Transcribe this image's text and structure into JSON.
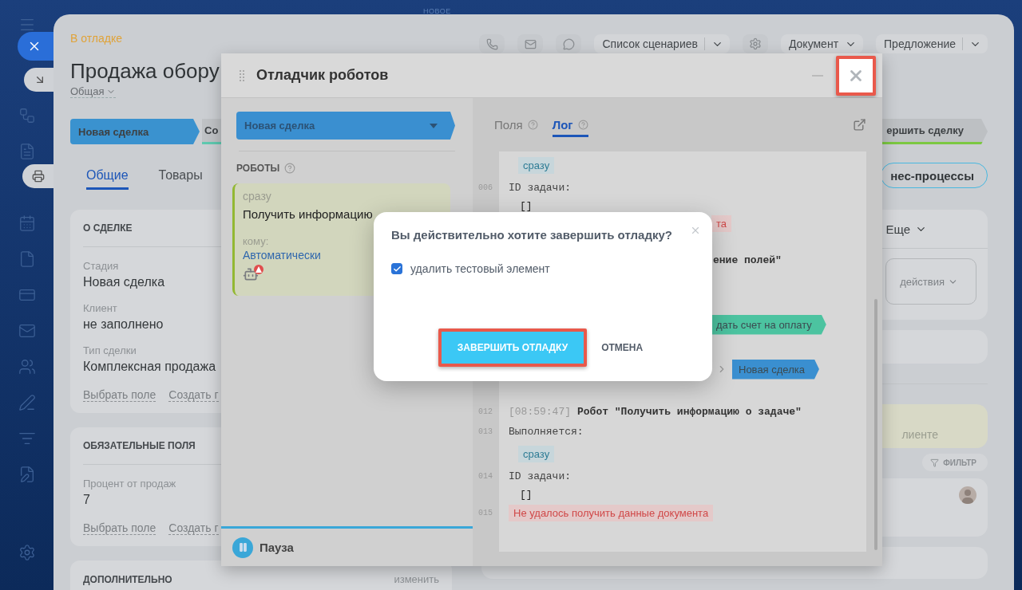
{
  "top_label": "НОВОЕ",
  "deal": {
    "status": "В отладке",
    "title": "Продажа обору",
    "category": "Общая",
    "toolbar": [
      {
        "label": "Список сценариев",
        "kind": "split"
      },
      {
        "label": "Документ",
        "kind": "dropdown"
      },
      {
        "label": "Предложение",
        "kind": "split"
      }
    ],
    "stages": [
      {
        "label": "Новая сделка",
        "kind": "current"
      },
      {
        "label": "Со",
        "kind": "next"
      },
      {
        "label": "ершить сделку",
        "kind": "final"
      }
    ],
    "tabs": [
      {
        "label": "Общие",
        "selected": true
      },
      {
        "label": "Товары",
        "selected": false
      }
    ],
    "processes_button": "нес-процессы",
    "sections": [
      {
        "title": "О СДЕЛКЕ",
        "fields": [
          {
            "label": "Стадия",
            "value": "Новая сделка"
          },
          {
            "label": "Клиент",
            "value": "не заполнено"
          },
          {
            "label": "Тип сделки",
            "value": "Комплексная продажа"
          }
        ],
        "links": [
          "Выбрать поле",
          "Создать г"
        ]
      },
      {
        "title": "ОБЯЗАТЕЛЬНЫЕ ПОЛЯ",
        "fields": [
          {
            "label": "Процент от продаж",
            "value": "7"
          }
        ],
        "links": [
          "Выбрать поле",
          "Создать г"
        ]
      },
      {
        "title": "ДОПОЛНИТЕЛЬНО",
        "action": "изменить"
      }
    ],
    "side": {
      "more": "Еще",
      "actions": "действия",
      "hint": "лиенте",
      "filter": "ФИЛЬТР"
    }
  },
  "debugger": {
    "title": "Отладчик роботов",
    "stage": "Новая сделка",
    "robots_heading": "РОБОТЫ",
    "robot": {
      "timing": "сразу",
      "name": "Получить информацию",
      "to_label": "кому:",
      "to_value": "Автоматически",
      "warning": true
    },
    "pause": "Пауза",
    "tabs": [
      {
        "label": "Поля",
        "selected": false
      },
      {
        "label": "Лог",
        "selected": true
      }
    ],
    "log": [
      {
        "kind": "tag",
        "text": "сразу"
      },
      {
        "kind": "text",
        "num": "006",
        "text": "ID задачи:"
      },
      {
        "kind": "value",
        "text": "[]"
      },
      {
        "kind": "error_fragment",
        "text": "та"
      },
      {
        "kind": "bold_fragment",
        "text": "ение  полей\""
      },
      {
        "kind": "stage_fragment",
        "text": "дать счет на оплату",
        "color": "#4cc3a0"
      },
      {
        "kind": "transition",
        "text": "Новая сделка",
        "color": "#3a8fd0"
      },
      {
        "kind": "title",
        "num": "012",
        "time": "[08:59:47]",
        "text": "Робот \"Получить информацию о задаче\""
      },
      {
        "kind": "text",
        "num": "013",
        "text": "Выполняется:"
      },
      {
        "kind": "tag",
        "text": "сразу"
      },
      {
        "kind": "text",
        "num": "014",
        "text": "ID задачи:"
      },
      {
        "kind": "value",
        "text": "[]"
      },
      {
        "kind": "error",
        "num": "015",
        "text": "Не удалось получить данные документа"
      }
    ]
  },
  "dialog": {
    "title": "Вы действительно хотите завершить отладку?",
    "option": {
      "label": "удалить тестовый элемент",
      "checked": true
    },
    "confirm": "ЗАВЕРШИТЬ ОТЛАДКУ",
    "cancel": "ОТМЕНА"
  }
}
